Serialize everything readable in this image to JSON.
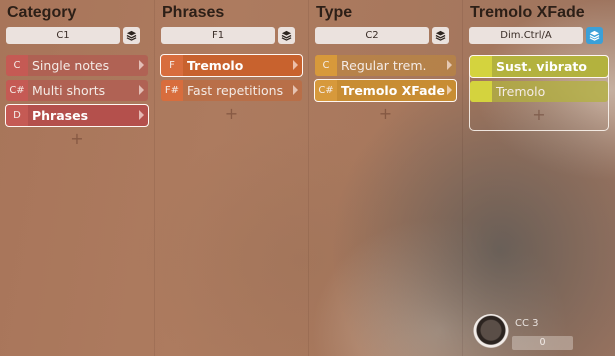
{
  "columns": [
    {
      "title": "Category",
      "selector": "C1",
      "articulations": [
        {
          "key": "C",
          "label": "Single notes"
        },
        {
          "key": "C#",
          "label": "Multi shorts"
        },
        {
          "key": "D",
          "label": "Phrases"
        }
      ],
      "add": "+"
    },
    {
      "title": "Phrases",
      "selector": "F1",
      "articulations": [
        {
          "key": "F",
          "label": "Tremolo"
        },
        {
          "key": "F#",
          "label": "Fast repetitions"
        }
      ],
      "add": "+"
    },
    {
      "title": "Type",
      "selector": "C2",
      "articulations": [
        {
          "key": "C",
          "label": "Regular trem."
        },
        {
          "key": "C#",
          "label": "Tremolo XFade"
        }
      ],
      "add": "+"
    },
    {
      "title": "Tremolo XFade",
      "selector": "Dim.Ctrl/A",
      "articulations": [
        {
          "key": "",
          "label": "Sust. vibrato"
        },
        {
          "key": "",
          "label": "Tremolo"
        }
      ],
      "add": "+"
    }
  ],
  "cc": {
    "label": "CC 3",
    "value": "0"
  },
  "icons": {
    "stack": "layers-icon",
    "arrow": "chevron-right-icon",
    "knob": "knob-icon"
  },
  "colors": {
    "category": "#b4504c",
    "phrases": "#c8622e",
    "type": "#c88d33",
    "xfade": "#b3b23e",
    "active_toggle": "#3ba0d8"
  }
}
